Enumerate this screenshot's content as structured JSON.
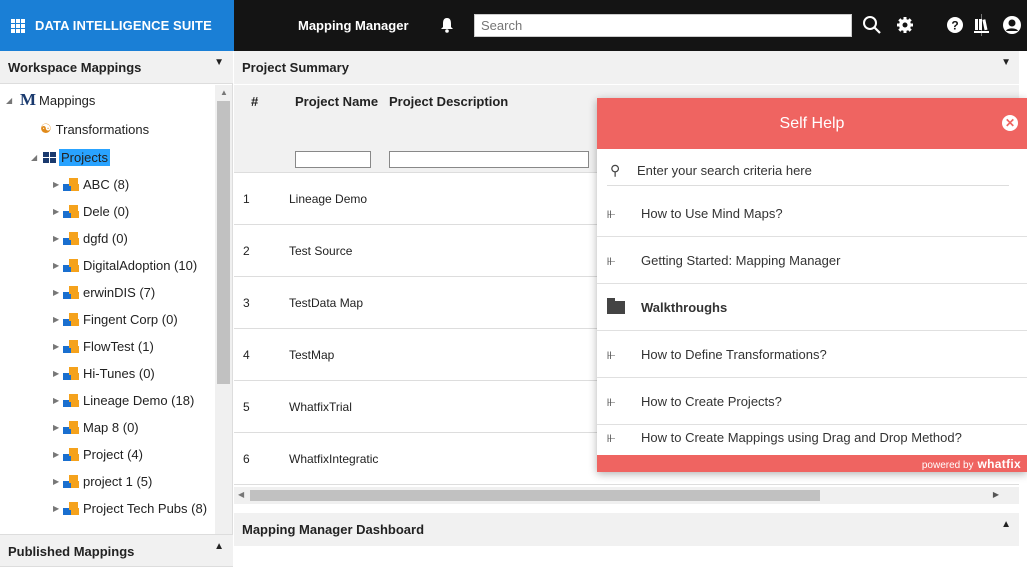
{
  "app": {
    "brand": "DATA INTELLIGENCE SUITE",
    "title": "Mapping Manager",
    "search_placeholder": "Search"
  },
  "left_panel": {
    "workspace_title": "Workspace Mappings",
    "published_title": "Published Mappings",
    "tree": {
      "root": "Mappings",
      "transformations": "Transformations",
      "projects": "Projects",
      "items": [
        "ABC (8)",
        "Dele (0)",
        "dgfd (0)",
        "DigitalAdoption (10)",
        "erwinDIS (7)",
        "Fingent Corp (0)",
        "FlowTest (1)",
        "Hi-Tunes (0)",
        "Lineage Demo (18)",
        "Map 8 (0)",
        "Project (4)",
        "project 1 (5)",
        "Project Tech Pubs (8)"
      ]
    }
  },
  "summary": {
    "title": "Project Summary",
    "columns": [
      "#",
      "Project Name",
      "Project Description"
    ],
    "rows": [
      {
        "num": "1",
        "name": "Lineage Demo"
      },
      {
        "num": "2",
        "name": "Test Source"
      },
      {
        "num": "3",
        "name": "TestData Map"
      },
      {
        "num": "4",
        "name": "TestMap"
      },
      {
        "num": "5",
        "name": "WhatfixTrial"
      },
      {
        "num": "6",
        "name": "WhatfixIntegratic"
      }
    ]
  },
  "dashboard": {
    "title": "Mapping Manager Dashboard"
  },
  "self_help": {
    "title": "Self Help",
    "search_placeholder": "Enter your search criteria here",
    "items": [
      {
        "label": "How to Use Mind Maps?",
        "type": "flow"
      },
      {
        "label": "Getting Started: Mapping Manager",
        "type": "flow"
      },
      {
        "label": "Walkthroughs",
        "type": "folder"
      },
      {
        "label": "How to Define Transformations?",
        "type": "flow"
      },
      {
        "label": "How to Create Projects?",
        "type": "flow"
      },
      {
        "label": "How to Create Mappings using Drag and Drop Method?",
        "type": "flow"
      }
    ],
    "footer_prefix": "powered by",
    "footer_brand": "whatfix"
  },
  "colors": {
    "brand_blue": "#1a7fd6",
    "topbar": "#141414",
    "self_help_red": "#ef6461"
  }
}
